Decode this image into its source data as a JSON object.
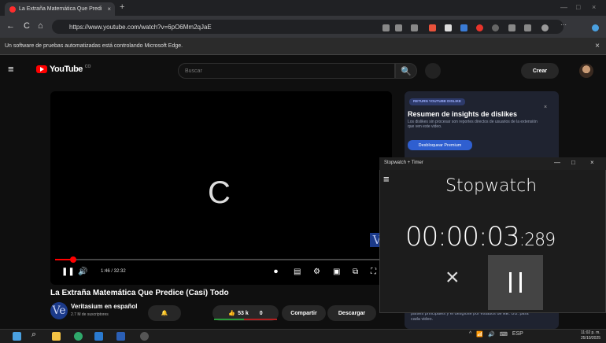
{
  "browser": {
    "tab_title": "La Extraña Matemática Que Predi",
    "tab_close": "×",
    "new_tab": "+",
    "url": "https://www.youtube.com/watch?v=6pO6Mm2qJaE",
    "infobar_text": "Un software de pruebas automatizadas está controlando Microsoft Edge.",
    "infobar_close": "×",
    "back": "←",
    "refresh": "C",
    "home": "⌂"
  },
  "youtube": {
    "logo_text": "YouTube",
    "logo_suffix": "CO",
    "search_placeholder": "Buscar",
    "search_icon": "🔍",
    "create_label": "Crear",
    "menu_icon": "≡"
  },
  "player": {
    "spinner": "C",
    "current_time": "1:46 / 32:32",
    "progress_fraction": 0.055,
    "channel_logo": "V"
  },
  "video": {
    "title": "La Extraña Matemática Que Predice (Casi) Todo",
    "channel_name": "Veritasium en español",
    "subscribers": "2.7 M de suscriptores",
    "channel_avatar": "Ve",
    "likes": "53 k",
    "dislikes": "0",
    "share_label": "Compartir",
    "download_label": "Descargar",
    "bell": "🔔"
  },
  "dislike_panel": {
    "tag": "RETURN YOUTUBE DISLIKE",
    "title": "Resumen de insights de dislikes",
    "text": "Los dislikes sin procesar son reportes directos de usuarios de la extensión que ven este video.",
    "button": "Desbloquear Premium",
    "close": "×",
    "footer": "países principales y el desglose por estados de EE. UU. para cada video."
  },
  "stopwatch": {
    "window_title": "Stopwatch + Timer",
    "minimize": "—",
    "maximize": "□",
    "close": "×",
    "menu": "≡",
    "heading": "Stopwatch",
    "time_main": "00:00:03",
    "time_ms": ":289",
    "reset": "×"
  },
  "taskbar": {
    "search_icon": "⌕",
    "language": "ESP",
    "time": "11:02 p. m.",
    "date": "25/10/2025"
  },
  "colors": {
    "accent_red": "#ff0000",
    "brand_blue": "#2f5fd0"
  }
}
